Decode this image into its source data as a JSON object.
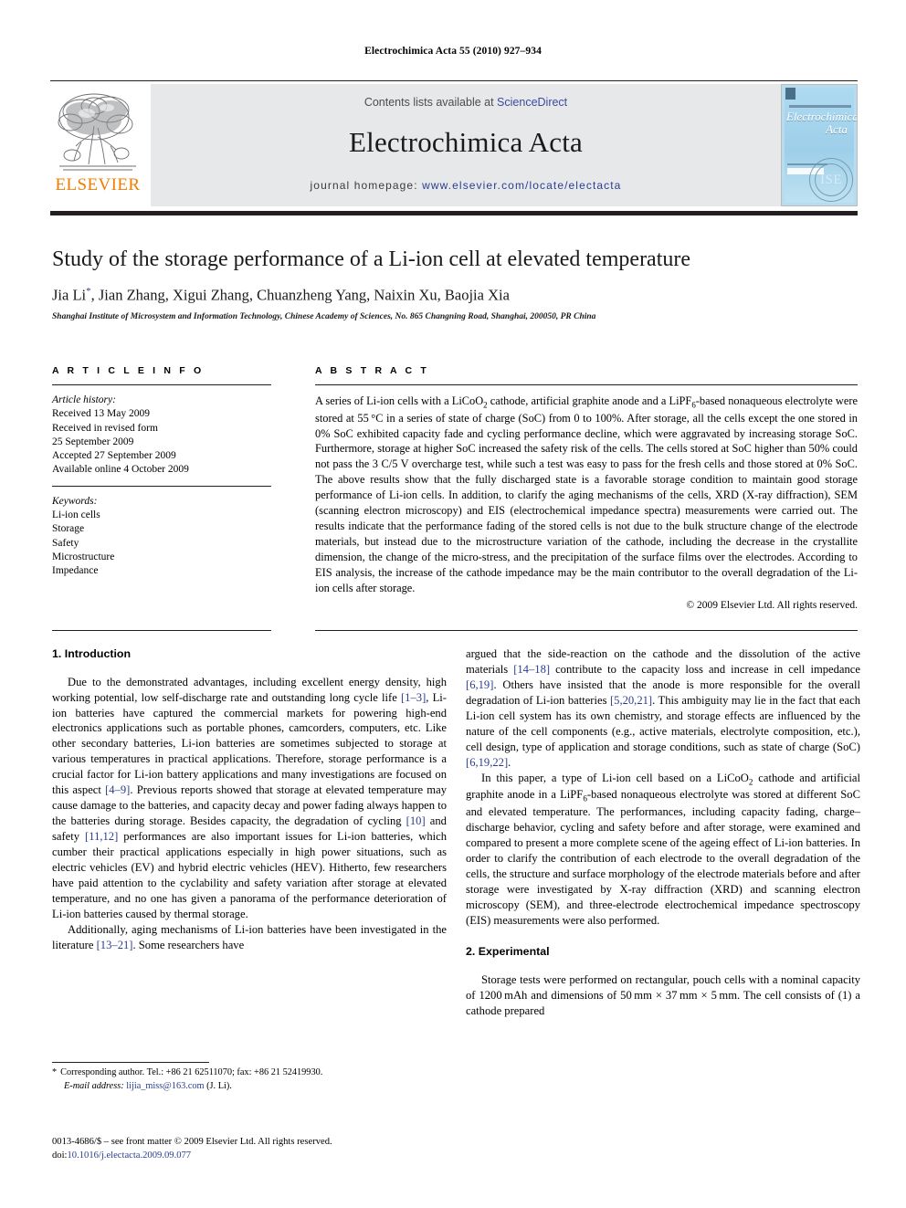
{
  "running_head": "Electrochimica Acta 55 (2010) 927–934",
  "masthead": {
    "contents_prefix": "Contents lists available at ",
    "sciencedirect": "ScienceDirect",
    "journal_title": "Electrochimica Acta",
    "homepage_prefix": "journal homepage: ",
    "homepage_url": "www.elsevier.com/locate/electacta",
    "publisher_wordmark": "ELSEVIER",
    "cover": {
      "title_line1": "Electrochimica",
      "title_line2": "Acta",
      "seal_text": "ISE"
    },
    "link_color": "#2b3d8f",
    "band_color": "#e7e8ea",
    "elsevier_orange": "#f07d00"
  },
  "article": {
    "title": "Study of the storage performance of a Li-ion cell at elevated temperature",
    "authors": "Jia Li*, Jian Zhang, Xigui Zhang, Chuanzheng Yang, Naixin Xu, Baojia Xia",
    "affiliation": "Shanghai Institute of Microsystem and Information Technology, Chinese Academy of Sciences, No. 865 Changning Road, Shanghai, 200050, PR China"
  },
  "article_info": {
    "heading": "A R T I C L E   I N F O",
    "history_label": "Article history:",
    "history": [
      "Received 13 May 2009",
      "Received in revised form",
      "25 September 2009",
      "Accepted 27 September 2009",
      "Available online 4 October 2009"
    ],
    "keywords_label": "Keywords:",
    "keywords": [
      "Li-ion cells",
      "Storage",
      "Safety",
      "Microstructure",
      "Impedance"
    ]
  },
  "abstract": {
    "heading": "A B S T R A C T",
    "text": "A series of Li-ion cells with a LiCoO2 cathode, artificial graphite anode and a LiPF6-based nonaqueous electrolyte were stored at 55 °C in a series of state of charge (SoC) from 0 to 100%. After storage, all the cells except the one stored in 0% SoC exhibited capacity fade and cycling performance decline, which were aggravated by increasing storage SoC. Furthermore, storage at higher SoC increased the safety risk of the cells. The cells stored at SoC higher than 50% could not pass the 3 C/5 V overcharge test, while such a test was easy to pass for the fresh cells and those stored at 0% SoC. The above results show that the fully discharged state is a favorable storage condition to maintain good storage performance of Li-ion cells. In addition, to clarify the aging mechanisms of the cells, XRD (X-ray diffraction), SEM (scanning electron microscopy) and EIS (electrochemical impedance spectra) measurements were carried out. The results indicate that the performance fading of the stored cells is not due to the bulk structure change of the electrode materials, but instead due to the microstructure variation of the cathode, including the decrease in the crystallite dimension, the change of the micro-stress, and the precipitation of the surface films over the electrodes. According to EIS analysis, the increase of the cathode impedance may be the main contributor to the overall degradation of the Li-ion cells after storage.",
    "copyright": "© 2009 Elsevier Ltd. All rights reserved."
  },
  "body": {
    "section1_heading": "1.  Introduction",
    "section1_p1": "Due to the demonstrated advantages, including excellent energy density, high working potential, low self-discharge rate and outstanding long cycle life [1–3], Li-ion batteries have captured the commercial markets for powering high-end electronics applications such as portable phones, camcorders, computers, etc. Like other secondary batteries, Li-ion batteries are sometimes subjected to storage at various temperatures in practical applications. Therefore, storage performance is a crucial factor for Li-ion battery applications and many investigations are focused on this aspect [4–9]. Previous reports showed that storage at elevated temperature may cause damage to the batteries, and capacity decay and power fading always happen to the batteries during storage. Besides capacity, the degradation of cycling [10] and safety [11,12] performances are also important issues for Li-ion batteries, which cumber their practical applications especially in high power situations, such as electric vehicles (EV) and hybrid electric vehicles (HEV). Hitherto, few researchers have paid attention to the cyclability and safety variation after storage at elevated temperature, and no one has given a panorama of the performance deterioration of Li-ion batteries caused by thermal storage.",
    "section1_p2": "Additionally, aging mechanisms of Li-ion batteries have been investigated in the literature [13–21]. Some researchers have",
    "section1_p3": "argued that the side-reaction on the cathode and the dissolution of the active materials [14–18] contribute to the capacity loss and increase in cell impedance [6,19]. Others have insisted that the anode is more responsible for the overall degradation of Li-ion batteries [5,20,21]. This ambiguity may lie in the fact that each Li-ion cell system has its own chemistry, and storage effects are influenced by the nature of the cell components (e.g., active materials, electrolyte composition, etc.), cell design, type of application and storage conditions, such as state of charge (SoC) [6,19,22].",
    "section1_p4": "In this paper, a type of Li-ion cell based on a LiCoO2 cathode and artificial graphite anode in a LiPF6-based nonaqueous electrolyte was stored at different SoC and elevated temperature. The performances, including capacity fading, charge–discharge behavior, cycling and safety before and after storage, were examined and compared to present a more complete scene of the ageing effect of Li-ion batteries. In order to clarify the contribution of each electrode to the overall degradation of the cells, the structure and surface morphology of the electrode materials before and after storage were investigated by X-ray diffraction (XRD) and scanning electron microscopy (SEM), and three-electrode electrochemical impedance spectroscopy (EIS) measurements were also performed.",
    "section2_heading": "2.  Experimental",
    "section2_p1": "Storage tests were performed on rectangular, pouch cells with a nominal capacity of 1200 mAh and dimensions of 50 mm × 37 mm × 5 mm. The cell consists of (1) a cathode prepared"
  },
  "footnote": {
    "star": "*",
    "line1": "Corresponding author. Tel.: +86 21 62511070; fax: +86 21 52419930.",
    "email_label": "E-mail address:",
    "email": "lijia_miss@163.com",
    "email_suffix": "(J. Li)."
  },
  "imprint": {
    "line1": "0013-4686/$ – see front matter © 2009 Elsevier Ltd. All rights reserved.",
    "doi_label": "doi:",
    "doi": "10.1016/j.electacta.2009.09.077"
  }
}
